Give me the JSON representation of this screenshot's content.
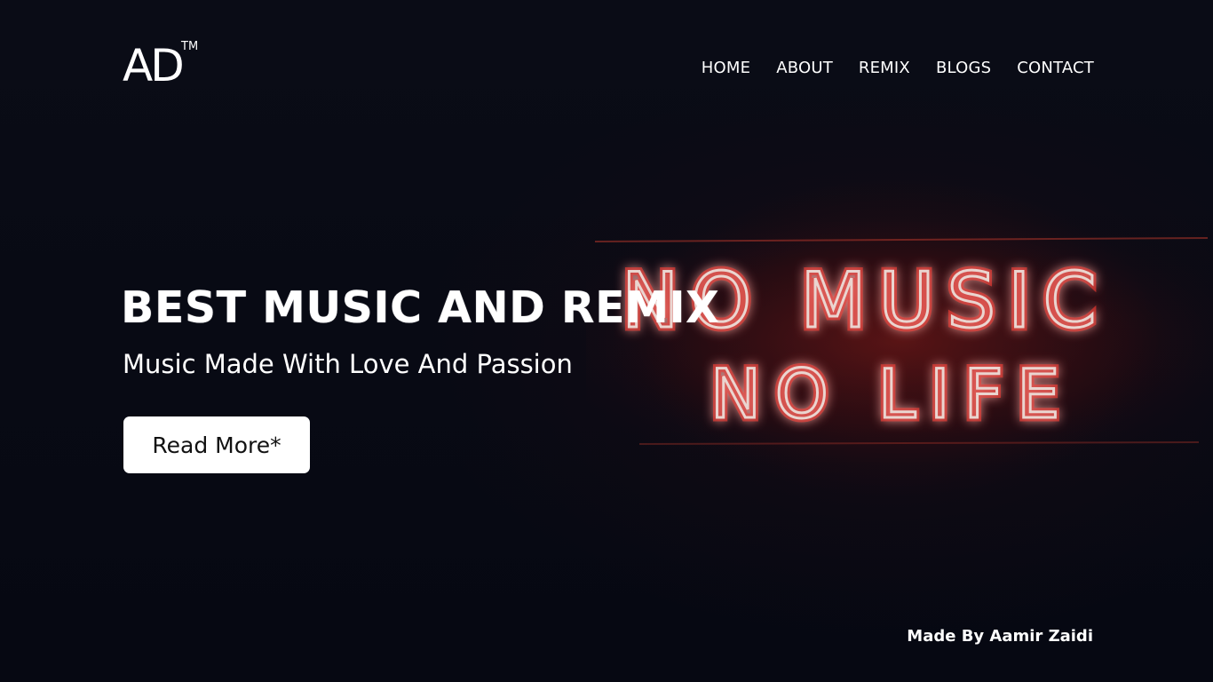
{
  "brand": {
    "logo_text": "AD",
    "trademark": "TM"
  },
  "nav": {
    "items": [
      {
        "label": "HOME"
      },
      {
        "label": "ABOUT"
      },
      {
        "label": "REMIX"
      },
      {
        "label": "BLOGS"
      },
      {
        "label": "CONTACT"
      }
    ]
  },
  "hero": {
    "title": "BEST MUSIC AND REMIX",
    "subtitle": "Music Made With Love And Passion",
    "cta_label": "Read More*"
  },
  "neon_sign": {
    "line1": "NO MUSIC",
    "line2": "NO LIFE",
    "glow_color": "#e5322a",
    "tube_color": "#e9d6d2"
  },
  "footer": {
    "credit": "Made By Aamir Zaidi"
  }
}
